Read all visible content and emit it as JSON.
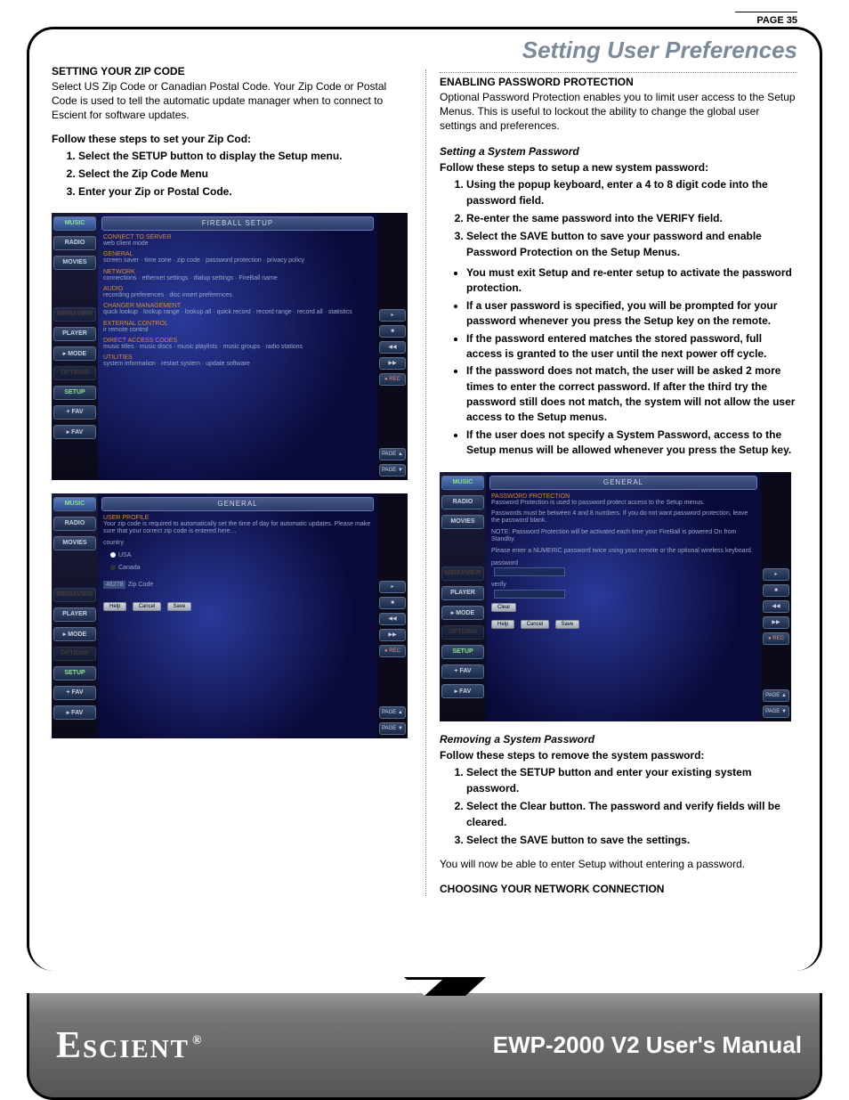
{
  "section_title": "Setting User Preferences",
  "left": {
    "h1": "SETTING YOUR ZIP CODE",
    "p1": "Select US Zip Code or Canadian Postal Code. Your Zip Code or Postal Code is used to tell the automatic update manager when to connect to Escient for software updates.",
    "steps_intro": "Follow these steps to set your Zip Cod:",
    "steps": [
      "Select the SETUP button to display the Setup menu.",
      "Select the Zip Code Menu",
      "Enter your Zip or Postal Code."
    ]
  },
  "shot1": {
    "title": "FIREBALL SETUP",
    "side": [
      "MUSIC",
      "RADIO",
      "MOVIES",
      "",
      "MENU/VIEW",
      "PLAYER",
      "▸ MODE",
      "OPTIONS",
      "SETUP",
      "+ FAV",
      "▸ FAV"
    ],
    "items": [
      {
        "hdr": "CONNECT TO SERVER",
        "sub": "web client mode"
      },
      {
        "hdr": "GENERAL",
        "sub": "screen saver · time zone · zip code · password protection · privacy policy"
      },
      {
        "hdr": "NETWORK",
        "sub": "connections · ethernet settings · dialup settings · FireBall name"
      },
      {
        "hdr": "AUDIO",
        "sub": "recording preferences · disc insert preferences"
      },
      {
        "hdr": "CHANGER MANAGEMENT",
        "sub": "quick lookup · lookup range · lookup all · quick record · record range · record all · statistics"
      },
      {
        "hdr": "EXTERNAL CONTROL",
        "sub": "ir remote control"
      },
      {
        "hdr": "DIRECT ACCESS CODES",
        "sub": "music titles · music discs · music playlists · music groups · radio stations"
      },
      {
        "hdr": "UTILITIES",
        "sub": "system information · restart system · update software"
      }
    ],
    "rbtns": [
      "▸",
      "■",
      "◀◀",
      "▶▶",
      "● REC",
      "PAGE ▲",
      "PAGE ▼"
    ]
  },
  "shot2": {
    "title": "GENERAL",
    "side": [
      "MUSIC",
      "RADIO",
      "MOVIES",
      "",
      "MENU/VIEW",
      "PLAYER",
      "▸ MODE",
      "OPTIONS",
      "SETUP",
      "+ FAV",
      "▸ FAV"
    ],
    "profile_hdr": "USER PROFILE",
    "profile_sub": "Your zip code is required to automatically set the time of day for automatic updates. Please make sure that your correct zip code is entered here…",
    "country_lbl": "country",
    "opt_usa": "USA",
    "opt_can": "Canada",
    "zip_field_lbl": "Zip Code",
    "zip_field_val": "46278",
    "btns": [
      "Help",
      "Cancel",
      "Save"
    ],
    "rbtns": [
      "▸",
      "■",
      "◀◀",
      "▶▶",
      "● REC",
      "PAGE ▲",
      "PAGE ▼"
    ]
  },
  "right": {
    "h1": "ENABLING PASSWORD PROTECTION",
    "p1": "Optional Password Protection enables you to limit user access to the Setup Menus. This is useful to lockout the ability to change the global user settings and preferences.",
    "h2": "Setting a System Password",
    "steps_intro": "Follow these steps to setup a new system password:",
    "steps": [
      "Using the popup keyboard, enter a 4 to 8 digit code into the password field.",
      "Re-enter the same password into the VERIFY field.",
      "Select the SAVE button to save your password and enable Password Protection on the Setup Menus."
    ],
    "bullets": [
      "You must exit Setup and re-enter setup to activate the password protection.",
      "If a user password is specified, you will be prompted for your password whenever you press the Setup key on the remote.",
      "If the password entered matches the stored password, full access is granted to the user until the next power off cycle.",
      "If the password does not match, the user will be asked 2 more times to enter the correct password. If after the third try the password still does not match, the system will not allow the user access to the Setup menus.",
      "If the user does not specify a System Password, access to the Setup menus will be allowed whenever you press the Setup key."
    ],
    "h3": "Removing a System Password",
    "rem_intro": "Follow these steps to remove the system password:",
    "rem_steps": [
      "Select the SETUP button and enter your existing system password.",
      "Select the Clear button. The password and verify fields will be cleared.",
      "Select the SAVE button to save the settings."
    ],
    "rem_after": "You will now be able to enter Setup without entering a password.",
    "h4": "CHOOSING YOUR NETWORK CONNECTION"
  },
  "shot3": {
    "title": "GENERAL",
    "side": [
      "MUSIC",
      "RADIO",
      "MOVIES",
      "",
      "MENU/VIEW",
      "PLAYER",
      "▸ MODE",
      "OPTIONS",
      "SETUP",
      "+ FAV",
      "▸ FAV"
    ],
    "pp_hdr": "PASSWORD PROTECTION",
    "pp_l1": "Password Protection is used to password protect access to the Setup menus.",
    "pp_l2": "Passwords must be between 4 and 8 numbers. If you do not want password protection, leave the password blank.",
    "pp_l3": "NOTE: Password Protection will be activated each time your FireBall is powered On from Standby.",
    "pp_l4": "Please enter a NUMERIC password twice using your remote or the optional wireless keyboard.",
    "pw_lbl": "password",
    "vf_lbl": "verify",
    "clear": "Clear",
    "btns": [
      "Help",
      "Cancel",
      "Save"
    ],
    "rbtns": [
      "▸",
      "■",
      "◀◀",
      "▶▶",
      "● REC",
      "PAGE ▲",
      "PAGE ▼"
    ]
  },
  "footer": {
    "page": "PAGE 35",
    "logo": "Escient",
    "reg": "®",
    "product": "EWP-2000 V2 User's Manual"
  }
}
